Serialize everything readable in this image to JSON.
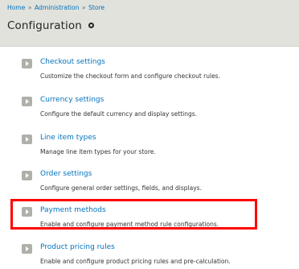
{
  "breadcrumb": {
    "items": [
      "Home",
      "Administration",
      "Store"
    ],
    "separator": "»"
  },
  "page": {
    "title": "Configuration",
    "shortcut_icon": "shortcut-add-icon"
  },
  "items": [
    {
      "label": "Checkout settings",
      "description": "Customize the checkout form and configure checkout rules."
    },
    {
      "label": "Currency settings",
      "description": "Configure the default currency and display settings."
    },
    {
      "label": "Line item types",
      "description": "Manage line item types for your store."
    },
    {
      "label": "Order settings",
      "description": "Configure general order settings, fields, and displays."
    },
    {
      "label": "Payment methods",
      "description": "Enable and configure payment method rule configurations."
    },
    {
      "label": "Product pricing rules",
      "description": "Enable and configure product pricing rules and pre-calculation."
    }
  ],
  "colors": {
    "link": "#0074bd",
    "header_bg": "#e1e2dc",
    "highlight": "#ff0000",
    "arrow_bg": "#b0b0ab"
  },
  "icons": {
    "item_arrow": "arrow-right-icon"
  }
}
